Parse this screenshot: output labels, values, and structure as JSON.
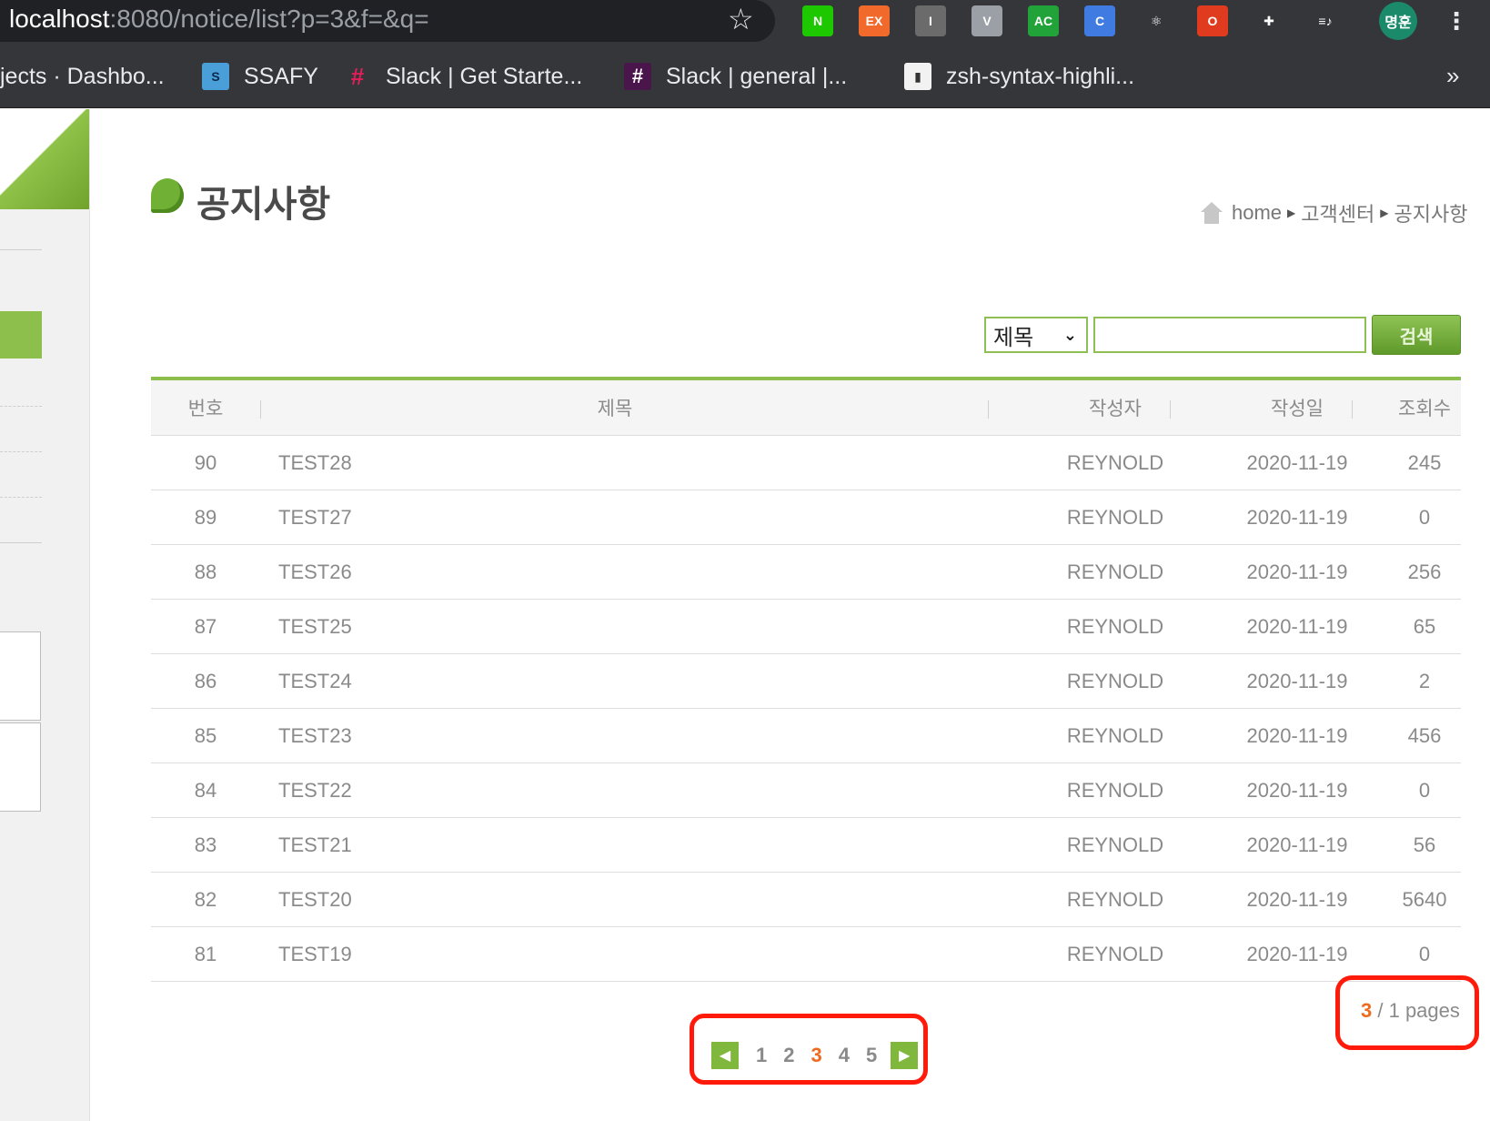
{
  "browser": {
    "url_host": "localhost",
    "url_rest": ":8080/notice/list?p=3&f=&q=",
    "extensions": [
      {
        "name": "naver-ext-icon",
        "label": "N",
        "color": "#1ec800"
      },
      {
        "name": "ex-ext-icon",
        "label": "EX",
        "color": "#f26a2b"
      },
      {
        "name": "i-ext-icon",
        "label": "I",
        "color": "#6b6b6b"
      },
      {
        "name": "vue-ext-icon",
        "label": "V",
        "color": "#9aa0a6"
      },
      {
        "name": "ac-ext-icon",
        "label": "AC",
        "color": "#22a33a"
      },
      {
        "name": "c-ext-icon",
        "label": "C",
        "color": "#3f7be0"
      },
      {
        "name": "react-ext-icon",
        "label": "⚛",
        "color": "#35363a"
      },
      {
        "name": "office-ext-icon",
        "label": "O",
        "color": "#e03a1f"
      },
      {
        "name": "puzzle-ext-icon",
        "label": "✚",
        "color": "#35363a"
      },
      {
        "name": "playlist-ext-icon",
        "label": "≡♪",
        "color": "#35363a"
      }
    ],
    "profile": "명훈",
    "bookmarks": [
      {
        "label": "jects · Dashbo...",
        "fav": ""
      },
      {
        "label": "SSAFY",
        "fav": "S"
      },
      {
        "label": "Slack | Get Starte...",
        "fav": "#"
      },
      {
        "label": "Slack | general |...",
        "fav": "#"
      },
      {
        "label": "zsh-syntax-highli...",
        "fav": "▮"
      }
    ],
    "more": "»"
  },
  "page": {
    "title": "공지사항",
    "breadcrumb": {
      "home": "home",
      "level1": "고객센터",
      "level2": "공지사항"
    }
  },
  "search": {
    "field_selected": "제목",
    "query": "",
    "button_label": "검색"
  },
  "table": {
    "headers": {
      "num": "번호",
      "title": "제목",
      "writer": "작성자",
      "date": "작성일",
      "hit": "조회수"
    },
    "rows": [
      {
        "num": "90",
        "title": "TEST28",
        "writer": "REYNOLD",
        "date": "2020-11-19",
        "hit": "245"
      },
      {
        "num": "89",
        "title": "TEST27",
        "writer": "REYNOLD",
        "date": "2020-11-19",
        "hit": "0"
      },
      {
        "num": "88",
        "title": "TEST26",
        "writer": "REYNOLD",
        "date": "2020-11-19",
        "hit": "256"
      },
      {
        "num": "87",
        "title": "TEST25",
        "writer": "REYNOLD",
        "date": "2020-11-19",
        "hit": "65"
      },
      {
        "num": "86",
        "title": "TEST24",
        "writer": "REYNOLD",
        "date": "2020-11-19",
        "hit": "2"
      },
      {
        "num": "85",
        "title": "TEST23",
        "writer": "REYNOLD",
        "date": "2020-11-19",
        "hit": "456"
      },
      {
        "num": "84",
        "title": "TEST22",
        "writer": "REYNOLD",
        "date": "2020-11-19",
        "hit": "0"
      },
      {
        "num": "83",
        "title": "TEST21",
        "writer": "REYNOLD",
        "date": "2020-11-19",
        "hit": "56"
      },
      {
        "num": "82",
        "title": "TEST20",
        "writer": "REYNOLD",
        "date": "2020-11-19",
        "hit": "5640"
      },
      {
        "num": "81",
        "title": "TEST19",
        "writer": "REYNOLD",
        "date": "2020-11-19",
        "hit": "0"
      }
    ]
  },
  "pagination": {
    "pages": [
      "1",
      "2",
      "3",
      "4",
      "5"
    ],
    "current": "3"
  },
  "page_count": {
    "current": "3",
    "separator": " / ",
    "total_text": "1 pages"
  },
  "colors": {
    "accent": "#8cbf4c",
    "current_page": "#f06a1d",
    "annotation": "#ff1a0a"
  }
}
